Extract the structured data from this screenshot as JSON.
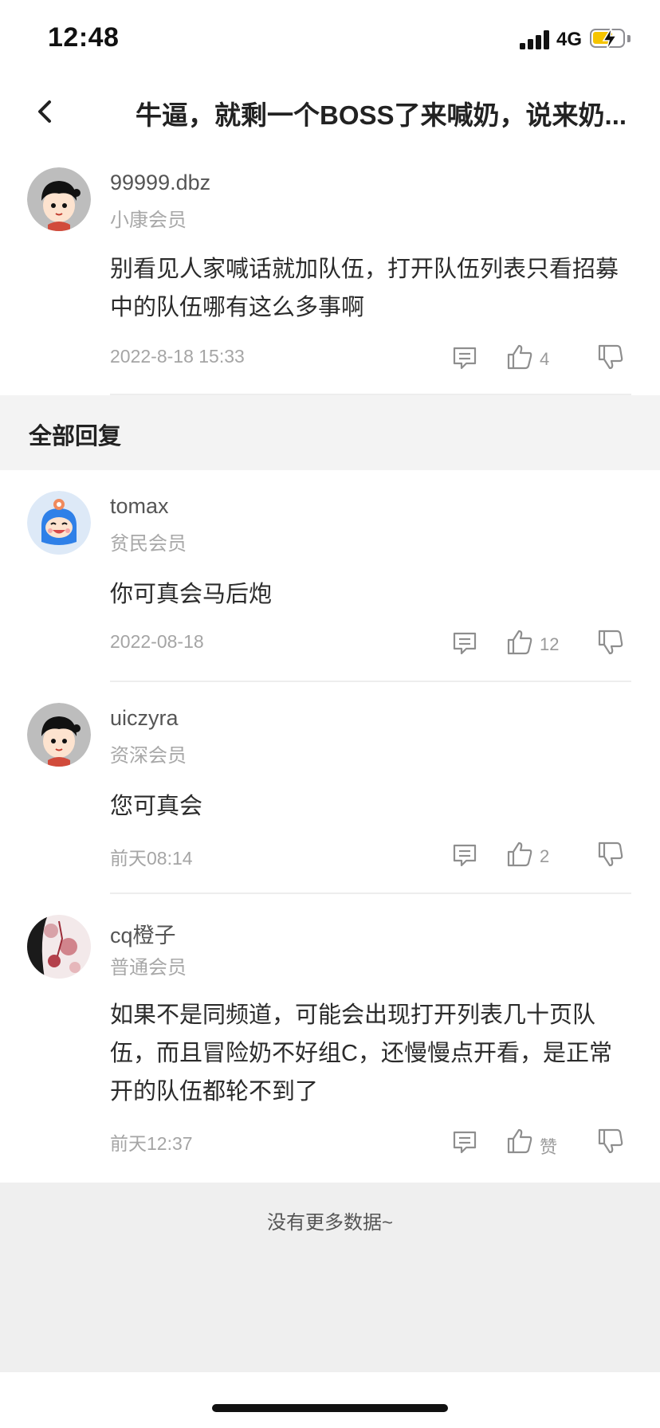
{
  "status_bar": {
    "time": "12:48",
    "network": "4G"
  },
  "nav": {
    "title": "牛逼，就剩一个BOSS了来喊奶，说来奶..."
  },
  "main_post": {
    "username": "99999.dbz",
    "level": "小康会员",
    "text": "别看见人家喊话就加队伍，打开队伍列表只看招募中的队伍哪有这么多事啊",
    "time": "2022-8-18 15:33",
    "likes": "4"
  },
  "replies_header": "全部回复",
  "replies": [
    {
      "username": "tomax",
      "level": "贫民会员",
      "text": "你可真会马后炮",
      "time": "2022-08-18",
      "likes": "12"
    },
    {
      "username": "uiczyra",
      "level": "资深会员",
      "text": "您可真会",
      "time": "前天08:14",
      "likes": "2"
    },
    {
      "username": "cq橙子",
      "level": "普通会员",
      "text": "如果不是同频道，可能会出现打开列表几十页队伍，而且冒险奶不好组C，还慢慢点开看，是正常开的队伍都轮不到了",
      "time": "前天12:37",
      "likes": "赞"
    }
  ],
  "footer": {
    "no_more": "没有更多数据~"
  },
  "colors": {
    "battery": "#f5c400",
    "section_bg": "#f3f3f3",
    "footer_bg": "#efefef"
  }
}
